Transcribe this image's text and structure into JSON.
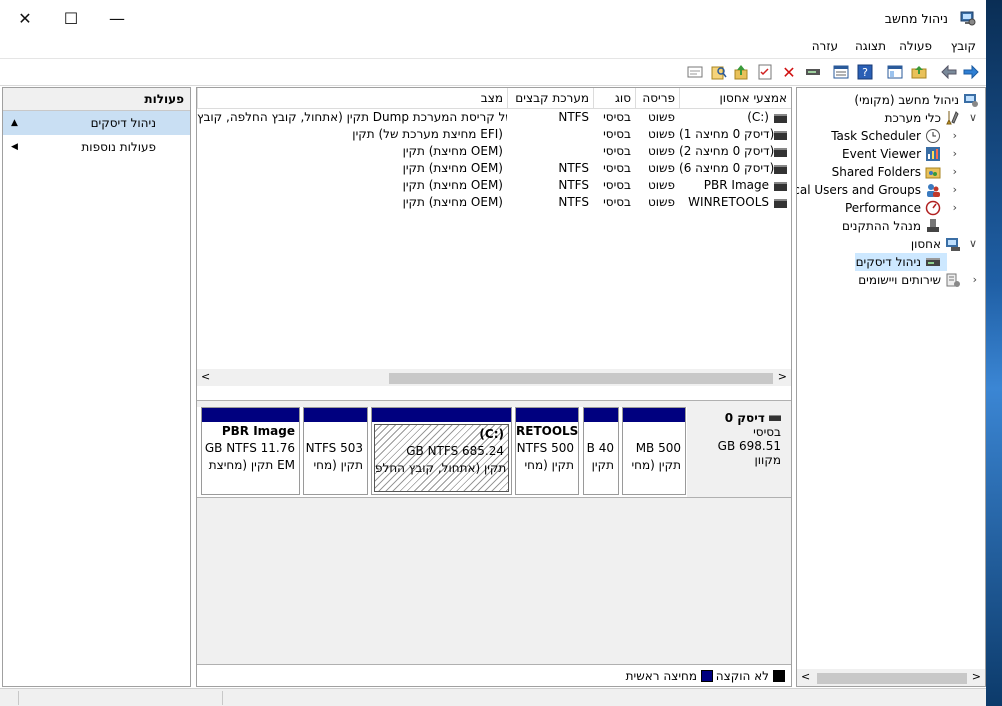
{
  "window": {
    "title": "ניהול מחשב",
    "controls": {
      "close": "✕",
      "maximize": "☐",
      "minimize": "—"
    }
  },
  "menu": [
    "קובץ",
    "פעולה",
    "תצוגה",
    "עזרה"
  ],
  "toolbar_icons": [
    "forward-icon",
    "back-icon",
    "up-folder-icon",
    "show-hide-tree-icon",
    "help-icon",
    "properties-icon",
    "connect-icon",
    "delete-icon",
    "checklist-icon",
    "up-arrow-icon",
    "search-icon",
    "view-icon"
  ],
  "actions_pane": {
    "title": "פעולות",
    "items": [
      {
        "label": "ניהול דיסקים",
        "selected": true,
        "arrow": "▲"
      },
      {
        "label": "פעולות נוספות",
        "selected": false,
        "arrow": "◀"
      }
    ]
  },
  "volume_table": {
    "columns": [
      "אמצעי אחסון",
      "פריסה",
      "סוג",
      "מערכת קבצים",
      "מצב"
    ],
    "rows": [
      {
        "volume": "(C:)",
        "layout": "פשוט",
        "type": "בסיסי",
        "fs": "NTFS",
        "status": "תקין (אתחול, קובץ החלפה, קובץ Dump של קריסת המערכת"
      },
      {
        "volume": "(דיסק 0 מחיצה 1)",
        "layout": "פשוט",
        "type": "בסיסי",
        "fs": "",
        "status": "תקין (מחיצת מערכת של EFI)"
      },
      {
        "volume": "(דיסק 0 מחיצה 2)",
        "layout": "פשוט",
        "type": "בסיסי",
        "fs": "",
        "status": "תקין (מחיצת OEM)"
      },
      {
        "volume": "(דיסק 0 מחיצה 6)",
        "layout": "פשוט",
        "type": "בסיסי",
        "fs": "NTFS",
        "status": "תקין (מחיצת OEM)"
      },
      {
        "volume": "PBR Image",
        "layout": "פשוט",
        "type": "בסיסי",
        "fs": "NTFS",
        "status": "תקין (מחיצת OEM)"
      },
      {
        "volume": "WINRETOOLS",
        "layout": "פשוט",
        "type": "בסיסי",
        "fs": "NTFS",
        "status": "תקין (מחיצת OEM)"
      }
    ]
  },
  "disk": {
    "name": "דיסק 0",
    "type": "בסיסי",
    "size": "GB 698.51",
    "state": "מקוון",
    "partitions": [
      {
        "line1": "",
        "line2": "MB 500",
        "line3": "תקין (מחי"
      },
      {
        "line1": "",
        "line2": "B 40",
        "line3": "תקין"
      },
      {
        "line1": "RETOOLS",
        "line2": "NTFS 500",
        "line3": "תקין (מחי"
      },
      {
        "line1": "(C:)",
        "line2": "GB NTFS 685.24",
        "line3": "תקין (אתחול, קובץ החלפ"
      },
      {
        "line1": "",
        "line2": "NTFS 503",
        "line3": "תקין (מחי"
      },
      {
        "line1": "PBR Image",
        "line2": "GB NTFS 11.76",
        "line3": "תקין (מחיצת EM"
      }
    ]
  },
  "legend": {
    "unallocated": "לא הוקצה",
    "primary": "מחיצה ראשית",
    "colors": {
      "unallocated": "#000000",
      "primary": "#00007f"
    }
  },
  "tree": {
    "root": "ניהול מחשב (מקומי)",
    "system_tools": "כלי מערכת",
    "task_scheduler": "Task Scheduler",
    "event_viewer": "Event Viewer",
    "shared_folders": "Shared Folders",
    "local_users": "Local Users and Groups",
    "performance": "Performance",
    "device_manager": "מנהל ההתקנים",
    "storage": "אחסון",
    "disk_management": "ניהול דיסקים",
    "services": "שירותים ויישומים"
  },
  "colors": {
    "selection": "#cde8ff",
    "action_selected": "#c9dff3",
    "partition_band": "#00007f"
  }
}
